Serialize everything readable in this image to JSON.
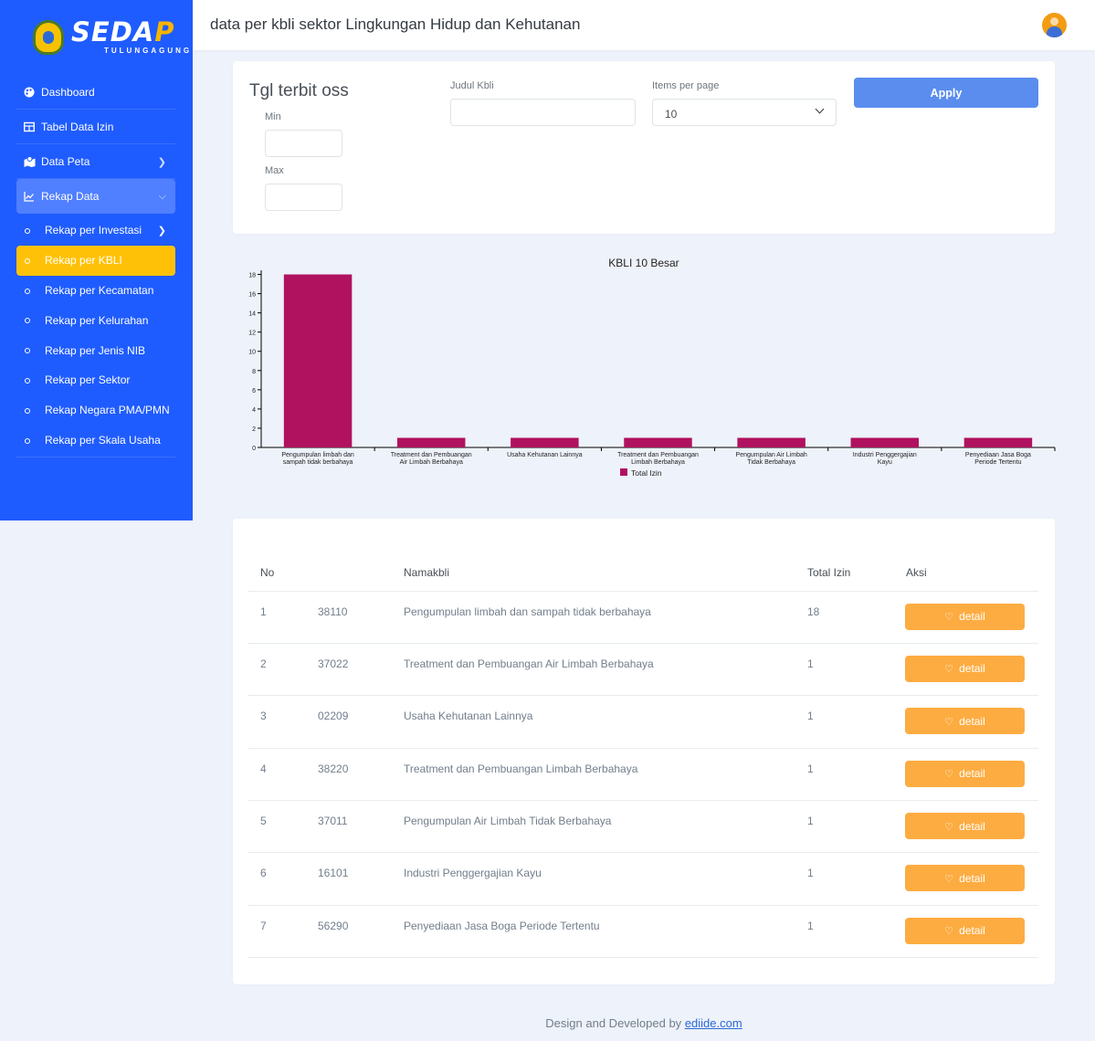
{
  "brand": {
    "name_main": "SEDA",
    "name_accent": "P",
    "subtitle": "TULUNGAGUNG"
  },
  "header": {
    "title": "data per kbli sektor Lingkungan Hidup dan Kehutanan"
  },
  "sidebar": {
    "items": [
      {
        "label": "Dashboard",
        "icon": "palette-icon"
      },
      {
        "label": "Tabel Data Izin",
        "icon": "table-icon"
      },
      {
        "label": "Data Peta",
        "icon": "map-icon"
      },
      {
        "label": "Rekap Data",
        "icon": "chart-line-icon"
      }
    ],
    "sub_items": [
      {
        "label": "Rekap per Investasi"
      },
      {
        "label": "Rekap per KBLI"
      },
      {
        "label": "Rekap per Kecamatan"
      },
      {
        "label": "Rekap per Kelurahan"
      },
      {
        "label": "Rekap per Jenis NIB"
      },
      {
        "label": "Rekap per Sektor"
      },
      {
        "label": "Rekap Negara PMA/PMN"
      },
      {
        "label": "Rekap per Skala Usaha"
      }
    ]
  },
  "filter": {
    "title": "Tgl terbit oss",
    "min_label": "Min",
    "max_label": "Max",
    "judul_label": "Judul Kbli",
    "items_label": "Items per page",
    "items_value": "10",
    "apply_label": "Apply"
  },
  "chart_data": {
    "type": "bar",
    "title": "KBLI 10 Besar",
    "categories": [
      "Pengumpulan limbah dan sampah tidak berbahaya",
      "Treatment dan Pembuangan Air Limbah Berbahaya",
      "Usaha Kehutanan Lainnya",
      "Treatment dan Pembuangan Limbah Berbahaya",
      "Pengumpulan Air Limbah Tidak Berbahaya",
      "Industri Penggergajian Kayu",
      "Penyediaan Jasa Boga Periode Tertentu"
    ],
    "series": [
      {
        "name": "Total Izin",
        "values": [
          18,
          1,
          1,
          1,
          1,
          1,
          1
        ]
      }
    ],
    "ylim": [
      0,
      19
    ],
    "yticks": [
      0,
      2,
      4,
      6,
      8,
      10,
      12,
      14,
      16,
      18
    ],
    "color": "#b0125f",
    "legend": "bottom"
  },
  "table": {
    "headers": [
      "No",
      "",
      "Namakbli",
      "Total Izin",
      "Aksi"
    ],
    "button_label": "detail",
    "rows": [
      {
        "no": "1",
        "kode": "38110",
        "nama": "Pengumpulan limbah dan sampah tidak berbahaya",
        "total": "18"
      },
      {
        "no": "2",
        "kode": "37022",
        "nama": "Treatment dan Pembuangan Air Limbah Berbahaya",
        "total": "1"
      },
      {
        "no": "3",
        "kode": "02209",
        "nama": "Usaha Kehutanan Lainnya",
        "total": "1"
      },
      {
        "no": "4",
        "kode": "38220",
        "nama": "Treatment dan Pembuangan Limbah Berbahaya",
        "total": "1"
      },
      {
        "no": "5",
        "kode": "37011",
        "nama": "Pengumpulan Air Limbah Tidak Berbahaya",
        "total": "1"
      },
      {
        "no": "6",
        "kode": "16101",
        "nama": "Industri Penggergajian Kayu",
        "total": "1"
      },
      {
        "no": "7",
        "kode": "56290",
        "nama": "Penyediaan Jasa Boga Periode Tertentu",
        "total": "1"
      }
    ]
  },
  "footer": {
    "text": "Design and Developed by",
    "link": "ediide.com"
  }
}
